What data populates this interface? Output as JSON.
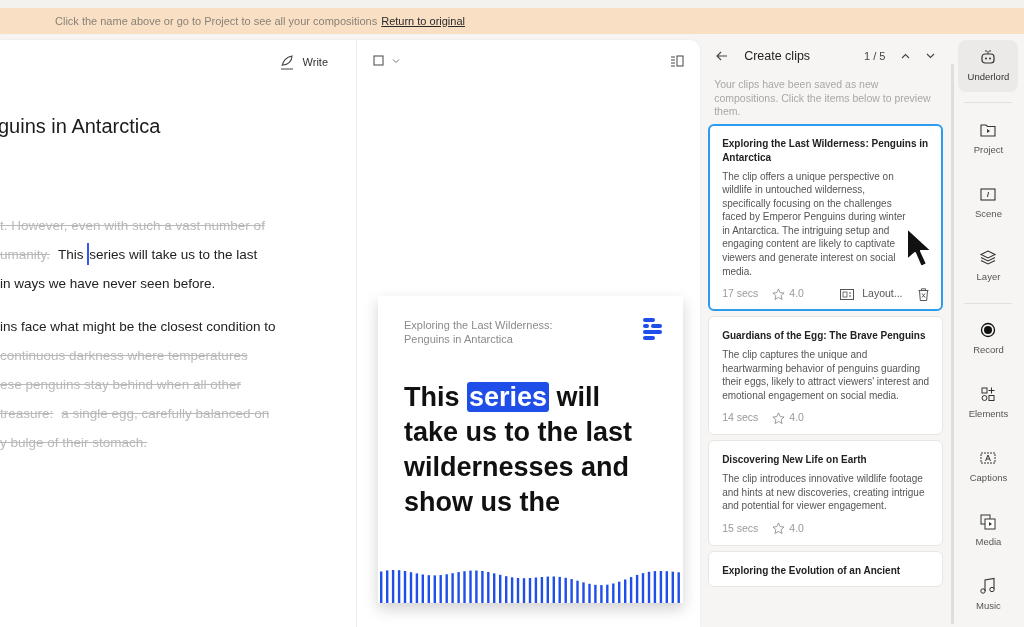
{
  "banner": {
    "text": "Click the name above or go to Project to see all your compositions",
    "link": "Return to original"
  },
  "editor": {
    "write_button": "Write",
    "title": "guins in Antarctica",
    "paragraphs": [
      {
        "lines": [
          [
            {
              "text": "t. However, even with such a vast number of",
              "struck": true
            }
          ],
          [
            {
              "text": "umanity.",
              "struck": true
            },
            {
              "text": "This series will take us to the last",
              "struck": false,
              "cursor": true
            }
          ],
          [
            {
              "text": "in ways we have never seen before.",
              "struck": false
            }
          ]
        ]
      },
      {
        "lines": [
          [
            {
              "text": "ins face what might be the closest condition to",
              "struck": false
            }
          ],
          [
            {
              "text": "continuous darkness where temperatures",
              "struck": true
            }
          ],
          [
            {
              "text": "ese penguins stay behind when all other",
              "struck": true
            }
          ],
          [
            {
              "text": "treasure:",
              "struck": true
            },
            {
              "text": "a single egg, carefully balanced on",
              "struck": true
            }
          ],
          [
            {
              "text": "y bulge of their stomach.",
              "struck": true
            }
          ]
        ]
      }
    ]
  },
  "preview": {
    "subtitle": "Exploring the Last Wilderness: Penguins in Antarctica",
    "caption_before": "This",
    "caption_highlight": "series",
    "caption_after": "will take us to the last wildernesses and show us the"
  },
  "clips_panel": {
    "title": "Create clips",
    "counter": "1 / 5",
    "intro": "Your clips have been saved as new compositions. Click the items below to preview them.",
    "clips": [
      {
        "title": "Exploring the Last Wilderness: Penguins in Antarctica",
        "description": "The clip offers a unique perspective on wildlife in untouched wilderness, specifically focusing on the challenges faced by Emperor Penguins during winter in Antarctica. The intriguing setup and engaging content are likely to captivate viewers and generate interest on social media.",
        "duration": "17 secs",
        "rating": "4.0",
        "layout": "Layout...",
        "selected": true
      },
      {
        "title": "Guardians of the Egg: The Brave Penguins",
        "description": "The clip captures the unique and heartwarming behavior of penguins guarding their eggs, likely to attract viewers' interest and emotional engagement on social media.",
        "duration": "14 secs",
        "rating": "4.0",
        "selected": false
      },
      {
        "title": "Discovering New Life on Earth",
        "description": "The clip introduces innovative wildlife footage and hints at new discoveries, creating intrigue and potential for viewer engagement.",
        "duration": "15 secs",
        "rating": "4.0",
        "selected": false
      },
      {
        "title": "Exploring the Evolution of an Ancient",
        "selected": false
      }
    ]
  },
  "sidebar": {
    "items": [
      {
        "label": "Underlord",
        "selected": true
      },
      {
        "label": "Project",
        "selected": false
      },
      {
        "label": "Scene",
        "selected": false
      },
      {
        "label": "Layer",
        "selected": false
      },
      {
        "label": "Record",
        "selected": false
      },
      {
        "label": "Elements",
        "selected": false
      },
      {
        "label": "Captions",
        "selected": false
      },
      {
        "label": "Media",
        "selected": false
      },
      {
        "label": "Music",
        "selected": false
      }
    ]
  }
}
